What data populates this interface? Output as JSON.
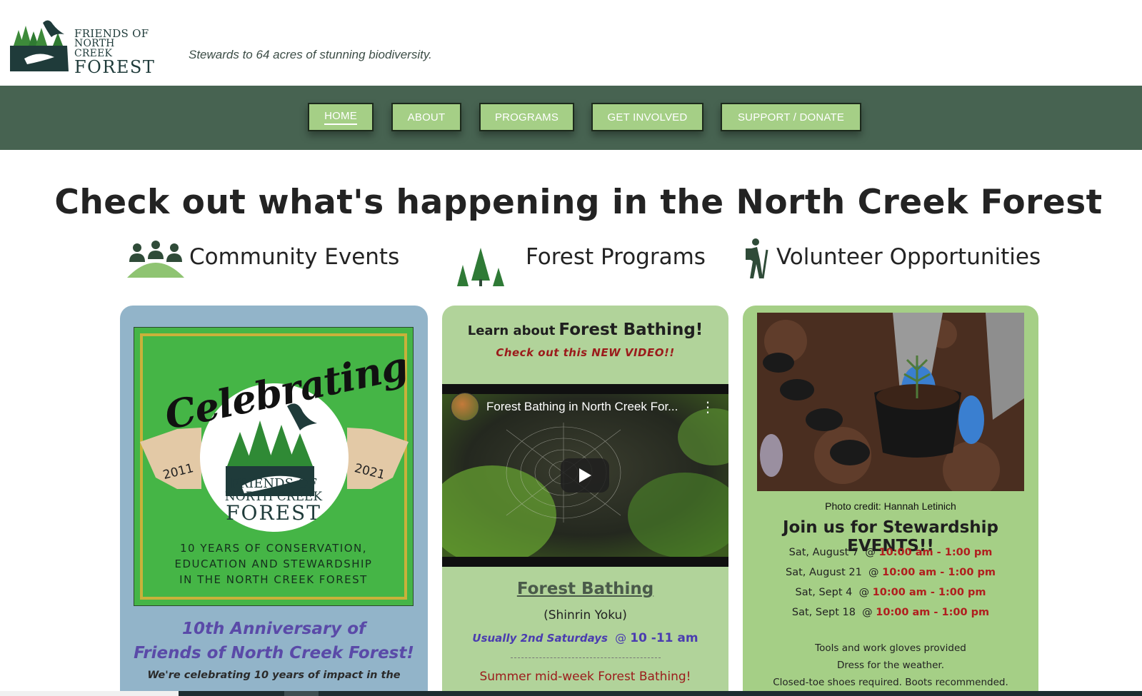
{
  "header": {
    "logo_line1": "FRIENDS OF",
    "logo_line2": "NORTH CREEK",
    "logo_line3": "FOREST",
    "tagline": "Stewards to 64 acres of stunning biodiversity."
  },
  "nav": {
    "items": [
      {
        "label": "HOME",
        "active": true
      },
      {
        "label": "ABOUT"
      },
      {
        "label": "PROGRAMS"
      },
      {
        "label": "GET INVOLVED"
      },
      {
        "label": "SUPPORT / DONATE"
      }
    ]
  },
  "main": {
    "title": "Check out what's happening in the North Creek Forest",
    "categories": [
      {
        "label": "Community Events",
        "icon": "people-group-icon"
      },
      {
        "label": "Forest Programs",
        "icon": "trees-icon"
      },
      {
        "label": "Volunteer Opportunities",
        "icon": "hiker-icon"
      }
    ]
  },
  "anniversary_card": {
    "badge_script": "Celebrating",
    "badge_year_left": "2011",
    "badge_year_right": "2021",
    "badge_logo_l1": "FRIENDS OF",
    "badge_logo_l2": "NORTH CREEK",
    "badge_logo_l3": "FOREST",
    "badge_caption_l1": "10 YEARS OF CONSERVATION,",
    "badge_caption_l2": "EDUCATION AND STEWARDSHIP",
    "badge_caption_l3": "IN THE NORTH CREEK FOREST",
    "heading_l1": "10th Anniversary of",
    "heading_l2": "Friends of North Creek Forest!",
    "subtext": "We're celebrating 10 years of impact in the"
  },
  "forest_bathing_card": {
    "learn_prefix": "Learn about",
    "learn_title": "Forest Bathing!",
    "new_video": "Check out this NEW VIDEO!!",
    "video_title": "Forest Bathing in North Creek For...",
    "heading": "Forest Bathing",
    "subheading": "(Shinrin Yoku)",
    "schedule_days": "Usually 2nd Saturdays",
    "schedule_at": "@",
    "schedule_time": "10 -11 am",
    "summer": "Summer mid-week Forest Bathing!"
  },
  "stewardship_card": {
    "photo_credit": "Photo credit: Hannah Letinich",
    "title": "Join us for Stewardship EVENTS!!",
    "events": [
      {
        "date": "Sat, August 7",
        "at": "@",
        "time": "10:00 am - 1:00 pm"
      },
      {
        "date": "Sat, August 21",
        "at": "@",
        "time": "10:00 am - 1:00 pm"
      },
      {
        "date": "Sat, Sept 4",
        "at": "@",
        "time": "10:00 am - 1:00 pm"
      },
      {
        "date": "Sat, Sept 18",
        "at": "@",
        "time": "10:00 am - 1:00 pm"
      }
    ],
    "notes": [
      "Tools and work gloves provided",
      "Dress for the weather.",
      "Closed-toe shoes required.  Boots recommended."
    ]
  },
  "colors": {
    "nav_bg": "#476351",
    "nav_button": "#a5cf86",
    "card_blue": "#92b4c9",
    "card_green_light": "#b1d39a",
    "card_green": "#a5cf86",
    "accent_red": "#b01e1e",
    "accent_purple": "#5a4aa8"
  }
}
